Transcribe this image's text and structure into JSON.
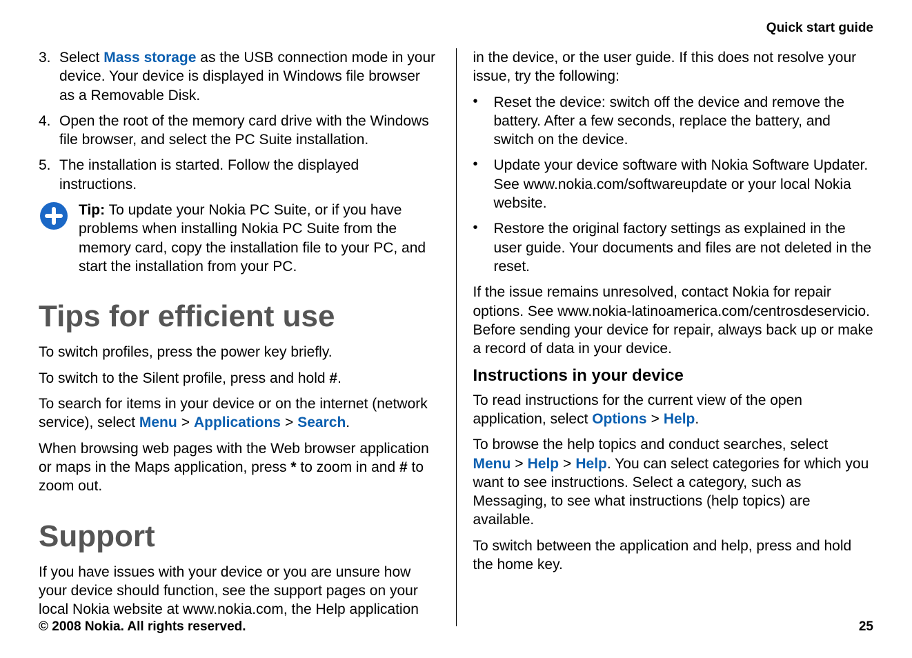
{
  "header": {
    "title": "Quick start guide"
  },
  "left": {
    "list": [
      {
        "num": "3.",
        "pre": "Select ",
        "link": "Mass storage",
        "post": " as the USB connection mode in your device. Your device is displayed in Windows file browser as a Removable Disk."
      },
      {
        "num": "4.",
        "text": "Open the root of the memory card drive with the Windows file browser, and select the PC Suite installation."
      },
      {
        "num": "5.",
        "text": "The installation is started. Follow the displayed instructions."
      }
    ],
    "tip_label": "Tip:",
    "tip_text": " To update your Nokia PC Suite, or if you have problems when installing Nokia PC Suite from the memory card, copy the installation file to your PC, and start the installation from your PC.",
    "h1_tips": "Tips for efficient use",
    "p1": "To switch profiles, press the power key briefly.",
    "p2_pre": "To switch to the Silent profile, press and hold ",
    "p2_hash": "#",
    "p2_post": ".",
    "p3_pre": "To search for items in your device or on the internet (network service), select ",
    "p3_menu": "Menu",
    "p3_apps": "Applications",
    "p3_search": "Search",
    "p3_post": ".",
    "p4_pre": "When browsing web pages with the Web browser application or maps in the Maps application, press ",
    "p4_star": "*",
    "p4_mid": " to zoom in and ",
    "p4_hash": "#",
    "p4_post": " to zoom out.",
    "h1_support": "Support",
    "p5": "If you have issues with your device or you are unsure how your device should function, see the support pages on your local Nokia website at www.nokia.com, the Help application"
  },
  "right": {
    "p1": "in the device, or the user guide. If this does not resolve your issue, try the following:",
    "bullets": [
      "Reset the device: switch off the device and remove the battery. After a few seconds, replace the battery, and switch on the device.",
      "Update your device software with Nokia Software Updater. See www.nokia.com/softwareupdate or your local Nokia website.",
      "Restore the original factory settings as explained in the user guide. Your documents and files are not deleted in the reset."
    ],
    "p2": "If the issue remains unresolved, contact Nokia for repair options. See www.nokia-latinoamerica.com/centrosdeservicio. Before sending your device for repair, always back up or make a record of data in your device.",
    "h2_instructions": "Instructions in your device",
    "p3_pre": "To read instructions for the current view of the open application, select ",
    "p3_options": "Options",
    "p3_help": "Help",
    "p3_post": ".",
    "p4_pre": "To browse the help topics and conduct searches, select ",
    "p4_menu": "Menu",
    "p4_help1": "Help",
    "p4_help2": "Help",
    "p4_post": ". You can select categories for which you want to see instructions. Select a category, such as Messaging, to see what instructions (help topics) are available.",
    "p5": "To switch between the application and help, press and hold the home key."
  },
  "footer": {
    "copyright": "© 2008 Nokia. All rights reserved.",
    "page": "25"
  },
  "glyphs": {
    "sep": ">",
    "bullet": "•"
  }
}
